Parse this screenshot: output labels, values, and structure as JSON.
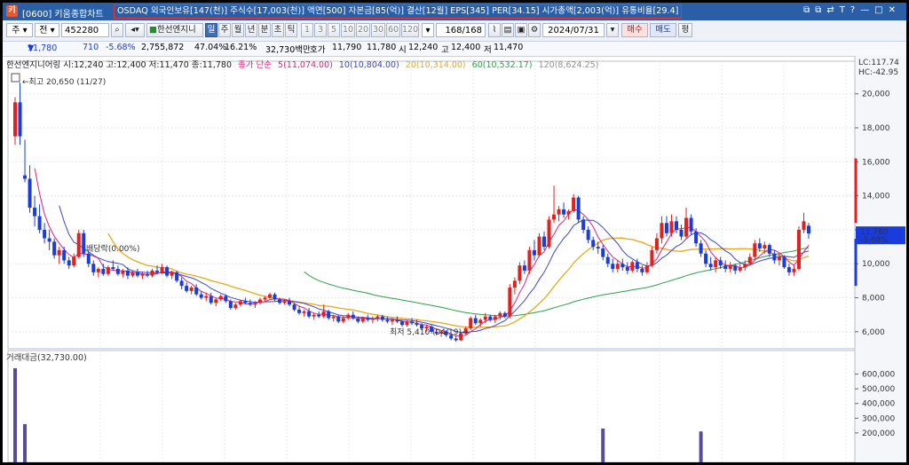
{
  "window": {
    "title": "[0600] 키움종합차트",
    "app_icon": "키",
    "info_bar": "OSDAQ 외국인보유[147(천)] 주식수[17,003(천)] 액면[500] 자본금[85(억)] 결산[12월] EPS[345] PER[34.15] 시가총액[2,003(억)] 유통비율[29.4]",
    "buttons": [
      "⧉",
      "⧉",
      "⇄",
      "T",
      "?",
      "—",
      "□",
      "✕"
    ]
  },
  "toolbar": {
    "type_select": "주",
    "jeon": "전",
    "code": "452280",
    "company": "한선엔지니",
    "periods": [
      "일",
      "주",
      "월",
      "년",
      "분",
      "초",
      "틱"
    ],
    "active_period": "일",
    "intervals": [
      "1",
      "3",
      "5",
      "10",
      "20",
      "30",
      "60",
      "120"
    ],
    "count": "168",
    "count_total": "/168",
    "date": "2024/07/31",
    "buy": "매수",
    "sell": "매도",
    "pyeong": "평"
  },
  "quote": {
    "price": "11,780",
    "arrow": "▼",
    "change": "710",
    "change_pct": "-5.68%",
    "volume": "2,755,872",
    "vol_ratio": "47.04%",
    "turnover": "16.21%",
    "amount": "32,730백만",
    "hoga_label": "호가",
    "hoga1": "11,790",
    "hoga2": "11,780",
    "open_label": "시",
    "open": "12,240",
    "high_label": "고",
    "high": "12,400",
    "low_label": "저",
    "low": "11,470"
  },
  "legend": {
    "stock": "한선엔지니어링 시:12,240 고:12,400 저:11,470 종:11,780",
    "ma_title": "종가 단순",
    "ma5": "5(11,074.00)",
    "ma10": "10(10,804.00)",
    "ma20": "20(10,314.00)",
    "ma60": "60(10,532.17)",
    "ma120": "120(8,624.25)",
    "volume": "거래대금(32,730.00)"
  },
  "annotations": {
    "high": "←최고 20,650 (11/27)",
    "low": "최저 5,410 (04/19)→",
    "dividend": "배당락(0.00%)"
  },
  "price_axis": {
    "lc": "LC:117.74",
    "hc": "HC:-42.95",
    "ticks": [
      "20,000",
      "18,000",
      "16,000",
      "14,000",
      "12,000",
      "10,000",
      "8,000",
      "6,000"
    ],
    "current_label": "11,780",
    "current_pct": "-5.68%"
  },
  "volume_axis": {
    "ticks": [
      "600,000",
      "500,000",
      "400,000",
      "300,000",
      "200,000"
    ]
  },
  "colors": {
    "up": "#e12020",
    "down": "#1b3cdc",
    "ma5": "#e0207a",
    "ma10": "#3848c8",
    "ma20": "#e8a818",
    "ma60": "#2ca048",
    "ma120": "#909090",
    "title_bar": "#2a5fa8"
  },
  "chart_data": {
    "type": "candlestick",
    "ylim": [
      5000,
      21500
    ],
    "high_point": {
      "date": "11/27",
      "value": 20650
    },
    "low_point": {
      "date": "04/19",
      "value": 5410
    },
    "candles": [
      [
        17500,
        19800,
        17000,
        19500
      ],
      [
        19500,
        20650,
        17000,
        17500
      ],
      [
        15200,
        17300,
        14800,
        15000
      ],
      [
        15000,
        15800,
        13000,
        13300
      ],
      [
        13300,
        14000,
        12200,
        12800
      ],
      [
        12800,
        13500,
        11800,
        12000
      ],
      [
        12000,
        12400,
        11200,
        11500
      ],
      [
        11500,
        12000,
        10800,
        11300
      ],
      [
        11300,
        11500,
        10300,
        10500
      ],
      [
        10500,
        11000,
        10000,
        10800
      ],
      [
        10800,
        11000,
        10000,
        10200
      ],
      [
        10200,
        10400,
        9700,
        9900
      ],
      [
        9900,
        10600,
        9800,
        10400
      ],
      [
        10400,
        12000,
        10300,
        11800
      ],
      [
        11800,
        12000,
        10400,
        10600
      ],
      [
        10600,
        10800,
        9800,
        10000
      ],
      [
        10000,
        10200,
        9300,
        9500
      ],
      [
        9500,
        9800,
        9200,
        9700
      ],
      [
        9700,
        10000,
        9300,
        9400
      ],
      [
        9400,
        9900,
        9300,
        9800
      ],
      [
        9800,
        10200,
        9600,
        9700
      ],
      [
        9700,
        9900,
        9300,
        9400
      ],
      [
        9400,
        9700,
        9200,
        9600
      ],
      [
        9600,
        9800,
        9100,
        9300
      ],
      [
        9300,
        9600,
        9200,
        9500
      ],
      [
        9500,
        9700,
        9200,
        9300
      ],
      [
        9300,
        9500,
        9100,
        9400
      ],
      [
        9400,
        9600,
        9200,
        9300
      ],
      [
        9300,
        9700,
        9200,
        9600
      ],
      [
        9600,
        9900,
        9400,
        9500
      ],
      [
        9500,
        10000,
        9400,
        9800
      ],
      [
        9800,
        9900,
        9200,
        9300
      ],
      [
        9300,
        9600,
        9100,
        9500
      ],
      [
        9500,
        9600,
        8900,
        9000
      ],
      [
        9000,
        9200,
        8500,
        8700
      ],
      [
        8700,
        8900,
        8300,
        8400
      ],
      [
        8400,
        8700,
        8200,
        8600
      ],
      [
        8600,
        8800,
        8100,
        8200
      ],
      [
        8200,
        8400,
        7900,
        8000
      ],
      [
        8000,
        8300,
        7800,
        8100
      ],
      [
        8100,
        8300,
        7600,
        7700
      ],
      [
        7700,
        8000,
        7500,
        7900
      ],
      [
        7900,
        8200,
        7800,
        8100
      ],
      [
        8100,
        8200,
        7700,
        7800
      ],
      [
        7800,
        7900,
        7300,
        7400
      ],
      [
        7400,
        7700,
        7300,
        7600
      ],
      [
        7600,
        7900,
        7500,
        7800
      ],
      [
        7800,
        8000,
        7600,
        7700
      ],
      [
        7700,
        7900,
        7500,
        7600
      ],
      [
        7600,
        7800,
        7400,
        7700
      ],
      [
        7700,
        8000,
        7600,
        7900
      ],
      [
        7900,
        8100,
        7800,
        8000
      ],
      [
        8000,
        8300,
        7900,
        8200
      ],
      [
        8200,
        8300,
        7800,
        7900
      ],
      [
        7900,
        8000,
        7600,
        7700
      ],
      [
        7700,
        7900,
        7600,
        7800
      ],
      [
        7800,
        8000,
        7500,
        7600
      ],
      [
        7600,
        7700,
        7200,
        7300
      ],
      [
        7300,
        7500,
        7000,
        7100
      ],
      [
        7100,
        7300,
        6900,
        7200
      ],
      [
        7200,
        7400,
        6800,
        6900
      ],
      [
        6900,
        7100,
        6700,
        7000
      ],
      [
        7000,
        7200,
        6800,
        6900
      ],
      [
        6900,
        7600,
        6800,
        7200
      ],
      [
        7200,
        7300,
        6700,
        6800
      ],
      [
        6800,
        7000,
        6600,
        6900
      ],
      [
        6900,
        7000,
        6500,
        6600
      ],
      [
        6600,
        6900,
        6500,
        6800
      ],
      [
        6800,
        7100,
        6700,
        7000
      ],
      [
        7000,
        7200,
        6700,
        6800
      ],
      [
        6800,
        6900,
        6500,
        6600
      ],
      [
        6600,
        6900,
        6500,
        6800
      ],
      [
        6800,
        7000,
        6600,
        6700
      ],
      [
        6700,
        6900,
        6500,
        6800
      ],
      [
        6800,
        7000,
        6600,
        6900
      ],
      [
        6900,
        7000,
        6600,
        6700
      ],
      [
        6700,
        6900,
        6500,
        6600
      ],
      [
        6600,
        6800,
        6400,
        6700
      ],
      [
        6700,
        6900,
        6500,
        6600
      ],
      [
        6600,
        6700,
        6300,
        6400
      ],
      [
        6400,
        6700,
        6300,
        6600
      ],
      [
        6600,
        6800,
        6400,
        6500
      ],
      [
        6500,
        6700,
        6300,
        6400
      ],
      [
        6400,
        6500,
        6100,
        6200
      ],
      [
        6200,
        6400,
        6000,
        6300
      ],
      [
        6300,
        6400,
        5900,
        6000
      ],
      [
        6000,
        6200,
        5800,
        5900
      ],
      [
        5900,
        6100,
        5700,
        6000
      ],
      [
        6000,
        6100,
        5700,
        5800
      ],
      [
        5800,
        5900,
        5500,
        5600
      ],
      [
        5600,
        5800,
        5410,
        5500
      ],
      [
        5500,
        6000,
        5450,
        5900
      ],
      [
        5900,
        6300,
        5800,
        6200
      ],
      [
        6200,
        6900,
        6100,
        6800
      ],
      [
        6800,
        7000,
        6400,
        6500
      ],
      [
        6500,
        6800,
        6300,
        6700
      ],
      [
        6700,
        7100,
        6500,
        6900
      ],
      [
        6900,
        7000,
        6600,
        6700
      ],
      [
        6700,
        7000,
        6500,
        6900
      ],
      [
        6900,
        7200,
        6700,
        7100
      ],
      [
        7100,
        7200,
        6800,
        6900
      ],
      [
        6900,
        8800,
        6800,
        8600
      ],
      [
        8600,
        9200,
        8200,
        9000
      ],
      [
        9000,
        10100,
        8800,
        9900
      ],
      [
        9900,
        10200,
        9400,
        9600
      ],
      [
        9600,
        11000,
        9400,
        10800
      ],
      [
        10800,
        11400,
        10200,
        10500
      ],
      [
        10500,
        11800,
        10400,
        11600
      ],
      [
        11600,
        11900,
        10800,
        11000
      ],
      [
        11000,
        12800,
        10900,
        12600
      ],
      [
        12600,
        14600,
        12400,
        12900
      ],
      [
        12900,
        13400,
        12500,
        13200
      ],
      [
        13200,
        13600,
        12700,
        12900
      ],
      [
        12900,
        13200,
        12600,
        13100
      ],
      [
        13100,
        14100,
        13000,
        13900
      ],
      [
        13900,
        14000,
        12400,
        12600
      ],
      [
        12600,
        12800,
        11800,
        12000
      ],
      [
        12000,
        12200,
        11200,
        11400
      ],
      [
        11400,
        11600,
        10800,
        11000
      ],
      [
        11000,
        11300,
        10600,
        10900
      ],
      [
        10900,
        11100,
        10200,
        10400
      ],
      [
        10400,
        10600,
        9800,
        10000
      ],
      [
        10000,
        10300,
        9500,
        9700
      ],
      [
        9700,
        10200,
        9500,
        10000
      ],
      [
        10000,
        10300,
        9600,
        9800
      ],
      [
        9800,
        10100,
        9400,
        9600
      ],
      [
        9600,
        10200,
        9500,
        10100
      ],
      [
        10100,
        10300,
        9500,
        9700
      ],
      [
        9700,
        9900,
        9300,
        9500
      ],
      [
        9500,
        10100,
        9400,
        9900
      ],
      [
        9900,
        11000,
        9800,
        10800
      ],
      [
        10800,
        11800,
        10600,
        11500
      ],
      [
        11500,
        12800,
        11200,
        12400
      ],
      [
        12400,
        12800,
        11600,
        11800
      ],
      [
        11800,
        12900,
        11600,
        12500
      ],
      [
        12500,
        12800,
        11800,
        12000
      ],
      [
        12000,
        12300,
        11400,
        11600
      ],
      [
        11600,
        13300,
        11500,
        12700
      ],
      [
        12700,
        12900,
        11700,
        11900
      ],
      [
        11900,
        12100,
        11000,
        11200
      ],
      [
        11200,
        11400,
        10400,
        10600
      ],
      [
        10600,
        10800,
        9800,
        10000
      ],
      [
        10000,
        10400,
        9600,
        9800
      ],
      [
        9800,
        10400,
        9500,
        10200
      ],
      [
        10200,
        10400,
        9700,
        9900
      ],
      [
        9900,
        10200,
        9500,
        9700
      ],
      [
        9700,
        10100,
        9500,
        9900
      ],
      [
        9900,
        10000,
        9400,
        9600
      ],
      [
        9600,
        10000,
        9500,
        9800
      ],
      [
        9800,
        10200,
        9600,
        10000
      ],
      [
        10000,
        10600,
        9900,
        10400
      ],
      [
        10400,
        11400,
        10300,
        11200
      ],
      [
        11200,
        11500,
        10700,
        10900
      ],
      [
        10900,
        11300,
        10600,
        11100
      ],
      [
        11100,
        11200,
        10400,
        10600
      ],
      [
        10600,
        10800,
        10000,
        10200
      ],
      [
        10200,
        10600,
        9900,
        10400
      ],
      [
        10400,
        10500,
        9700,
        9800
      ],
      [
        9800,
        10000,
        9300,
        9500
      ],
      [
        9500,
        9900,
        9300,
        9700
      ],
      [
        9700,
        12200,
        9600,
        12000
      ],
      [
        12000,
        13000,
        11800,
        12500
      ],
      [
        12240,
        12400,
        11470,
        11780
      ]
    ],
    "volume_spikes": [
      {
        "index": 0,
        "value": 640000
      },
      {
        "index": 2,
        "value": 260000
      },
      {
        "index": 120,
        "value": 230000
      },
      {
        "index": 140,
        "value": 210000
      }
    ]
  }
}
